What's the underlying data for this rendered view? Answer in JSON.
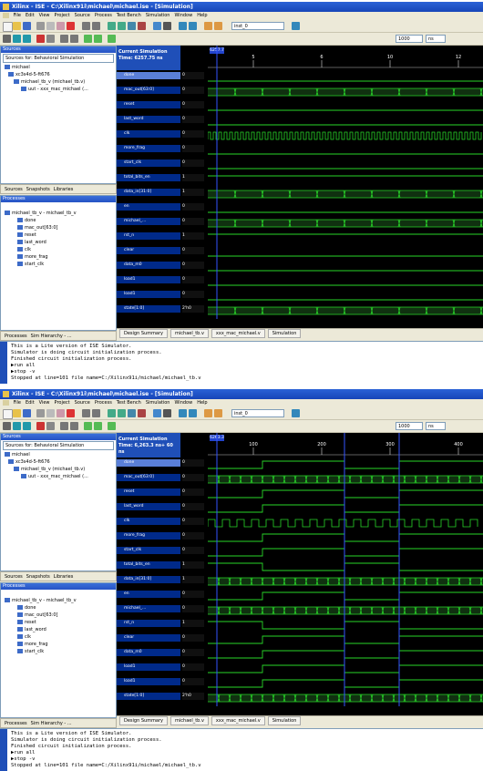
{
  "app": {
    "window_title_1": "Xilinx - ISE - C:\\Xilinx91i\\michael\\michael.ise - [Simulation]",
    "window_title_2": "Xilinx - ISE - C:\\Xilinx91i\\michael\\michael.ise - [Simulation]",
    "menu": [
      "File",
      "Edit",
      "View",
      "Project",
      "Source",
      "Process",
      "Test Bench",
      "Simulation",
      "Window",
      "Help"
    ],
    "run_combo": "inst_0",
    "time_combo_1": "1000",
    "time_combo_2": "1000",
    "unit_combo": "ns"
  },
  "sources_panel": {
    "title": "Sources",
    "sources_for": "Sources for: Behavioral Simulation",
    "tree": [
      "michael",
      "xc3s4d-5-ft676",
      "michael_tb_v (michael_tb.v)",
      "uut - xxx_mac_michael (..."
    ]
  },
  "bottom_tabs": [
    "Sources",
    "Snapshots",
    "Libraries"
  ],
  "processes_panel": {
    "title": "Processes",
    "instance": "michael_tb_v - michael_tb_v",
    "signals": [
      "done",
      "mac_out[63:0]",
      "reset",
      "last_word",
      "clk",
      "more_frag",
      "start_clk"
    ]
  },
  "process_tabs": [
    "Processes",
    "Sim Hierarchy - ..."
  ],
  "waveform": {
    "cst_label": "Current Simulation",
    "time_1": "Time: 6257.75 ns",
    "time_2": "Time: 6,263.3 ns+ 60 ns",
    "cursor_1": "6257.7",
    "cursor_2": "6263.3",
    "ticks_1": [
      "5",
      "6",
      "10",
      "12"
    ],
    "ticks_2": [
      "100",
      "200",
      "300",
      "400"
    ],
    "signals": [
      {
        "name": "done",
        "value": "0"
      },
      {
        "name": "mac_out[63:0]",
        "value": "0"
      },
      {
        "name": "reset",
        "value": "0"
      },
      {
        "name": "last_word",
        "value": "0"
      },
      {
        "name": "clk",
        "value": "0"
      },
      {
        "name": "more_frag",
        "value": "0"
      },
      {
        "name": "start_clk",
        "value": "0"
      },
      {
        "name": "total_bits_en",
        "value": "1"
      },
      {
        "name": "data_in[31:0]",
        "value": "1"
      },
      {
        "name": "en",
        "value": "0"
      },
      {
        "name": "michael_...",
        "value": "0"
      },
      {
        "name": "rst_n",
        "value": "1"
      },
      {
        "name": "clear",
        "value": "0"
      },
      {
        "name": "data_m0",
        "value": "0"
      },
      {
        "name": "load1",
        "value": "0"
      },
      {
        "name": "load1",
        "value": "0"
      },
      {
        "name": "state[1:0]",
        "value": "2'h0"
      }
    ]
  },
  "doc_tabs": [
    "Design Summary",
    "michael_tb.v",
    "xxx_mac_michael.v",
    "Simulation"
  ],
  "console_1": [
    "This is a Lite version of ISE Simulator.",
    "Simulator is doing circuit initialization process.",
    "Finished circuit initialization process.",
    "run all",
    "stop -v",
    "Stopped at line=101 file name=C:/Xilinx91i/michael/michael_tb.v"
  ],
  "console_2": [
    "This is a Lite version of ISE Simulator.",
    "Simulator is doing circuit initialization process.",
    "Finished circuit initialization process.",
    "run all",
    "stop -v",
    "Stopped at line=101 file name=C:/Xilinx91i/michael/michael_tb.v"
  ],
  "colors": {
    "title_blue": "#1645b8",
    "wave_green": "#29d629",
    "wave_bus": "#2e8b2e",
    "bg_black": "#000000",
    "cursor_blue": "#3355ff"
  }
}
